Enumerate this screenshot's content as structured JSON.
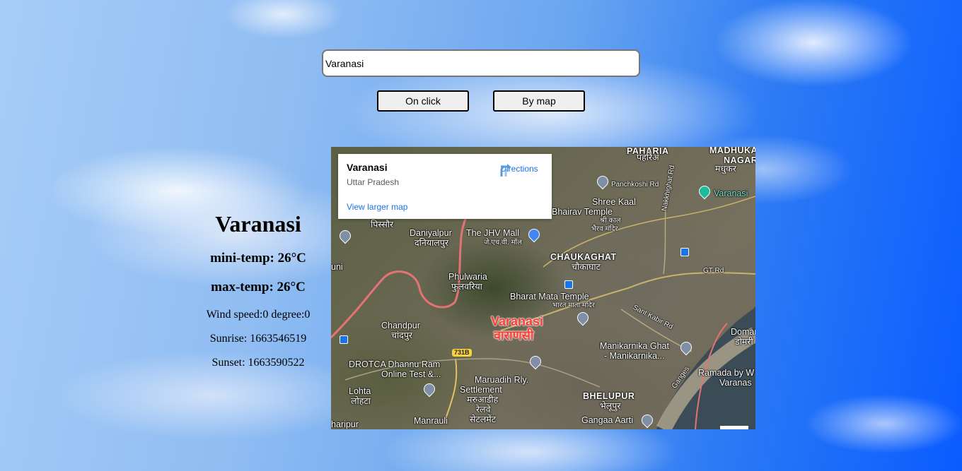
{
  "search": {
    "value": "Varanasi",
    "placeholder": ""
  },
  "buttons": {
    "on_click_label": "On click",
    "by_map_label": "By map"
  },
  "weather": {
    "city": "Varanasi",
    "min_temp": "mini-temp: 26°C",
    "max_temp": "max-temp: 26°C",
    "wind": "Wind speed:0 degree:0",
    "sunrise": "Sunrise: 1663546519",
    "sunset": "Sunset: 1663590522"
  },
  "map": {
    "card": {
      "title": "Varanasi",
      "subtitle": "Uttar Pradesh",
      "directions_label": "Directions",
      "larger_map_label": "View larger map"
    },
    "labels": {
      "paharia": "PAHARIA",
      "paharia_hi": "पहरिअ",
      "madhuban": "MADHUKA",
      "nagar": "NAGAR",
      "madhukar_hi": "मधुकर",
      "panchkoshi": "Panchkoshi Rd",
      "varanasi_teal": "Varanasi",
      "shree_kaal": "Shree Kaal",
      "bhairav": "Bhairav Temple",
      "bhairav_hi": "श्री काल",
      "bhairav_hi2": "भैरव मंदिर",
      "nakkhighat": "Nakkhighat Rd",
      "pissaur": "पिस्सौर",
      "daniyalpur": "Daniyalpur",
      "daniyalpur_hi": "दनियालपुर",
      "jhv_mall": "The JHV Mall",
      "jhv_mall_hi": "जे.एच.वी. मॉल",
      "chaukaghat": "CHAUKAGHAT",
      "chaukaghat_hi": "चौकाघाट",
      "gt_rd": "GT Rd",
      "phulwaria": "Phulwaria",
      "phulwaria_hi": "फुलवरिया",
      "uni": "uni",
      "bharat_mata": "Bharat Mata Temple",
      "bharat_mata_hi": "भारत माता मंदिर",
      "sant_kabir": "Sant Kabir Rd",
      "varanasi_big": "Varanasi",
      "varanasi_big_hi": "वाराणसी",
      "chandpur": "Chandpur",
      "chandpur_hi": "चांदपुर",
      "domari": "Domari",
      "domari_hi": "डोमरी",
      "manikarnika": "Manikarnika Ghat",
      "manikarnika2": "- Manikarnika...",
      "nh": "731B",
      "drotca": "DROTCA Dhannu Ram",
      "drotca2": "Online Test &...",
      "ramada": "Ramada by W",
      "ramada2": "Varanas",
      "ganges": "Ganges",
      "lohta": "Lohta",
      "lohta_hi": "लोहटा",
      "maruadih": "Maruadih Rly.",
      "maruadih2": "Settlement",
      "maruadih_hi": "मरुआडीह",
      "maruadih_hi2": "रेलवे",
      "maruadih_hi3": "सेटलमेंट",
      "bhelupur": "BHELUPUR",
      "bhelupur_hi": "भेलूपुर",
      "haripur": "haripur",
      "manrauli": "Manrauli",
      "gangaa_aarti": "Gangaa Aarti"
    }
  },
  "colors": {
    "link": "#1a73e8",
    "accent_red": "#ff3b30",
    "sky": "#0a5cff"
  }
}
